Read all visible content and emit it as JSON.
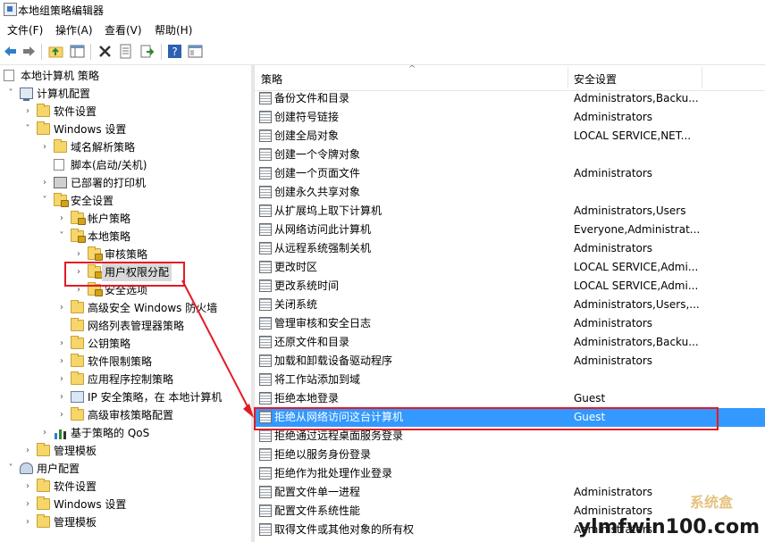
{
  "window": {
    "title": "本地组策略编辑器"
  },
  "menu": [
    "文件(F)",
    "操作(A)",
    "查看(V)",
    "帮助(H)"
  ],
  "toolbar": [
    "back-icon",
    "forward-icon",
    "up-folder-icon",
    "show-hide-tree-icon",
    "delete-icon",
    "properties-icon",
    "export-icon",
    "help-icon",
    "view-icon"
  ],
  "tree": [
    {
      "label": "本地计算机 策略",
      "icon": "doc",
      "expander": "",
      "name": "tree-root-local-policy"
    },
    {
      "label": "计算机配置",
      "icon": "computer",
      "expander": "v",
      "name": "tree-computer-config"
    },
    {
      "label": "软件设置",
      "icon": "folder",
      "expander": ">",
      "name": "tree-software-settings"
    },
    {
      "label": "Windows 设置",
      "icon": "folder",
      "expander": "v",
      "name": "tree-windows-settings"
    },
    {
      "label": "域名解析策略",
      "icon": "folder",
      "expander": ">",
      "name": "tree-name-resolution"
    },
    {
      "label": "脚本(启动/关机)",
      "icon": "doc",
      "expander": "",
      "name": "tree-scripts"
    },
    {
      "label": "已部署的打印机",
      "icon": "printer",
      "expander": ">",
      "name": "tree-printers"
    },
    {
      "label": "安全设置",
      "icon": "folder-lock",
      "expander": "v",
      "name": "tree-security-settings"
    },
    {
      "label": "帐户策略",
      "icon": "folder-lock",
      "expander": ">",
      "name": "tree-account-policies"
    },
    {
      "label": "本地策略",
      "icon": "folder-lock",
      "expander": "v",
      "name": "tree-local-policies"
    },
    {
      "label": "审核策略",
      "icon": "folder-lock",
      "expander": ">",
      "name": "tree-audit-policy"
    },
    {
      "label": "用户权限分配",
      "icon": "folder-lock",
      "expander": ">",
      "name": "tree-user-rights",
      "selected": true
    },
    {
      "label": "安全选项",
      "icon": "folder-lock",
      "expander": ">",
      "name": "tree-security-options"
    },
    {
      "label": "高级安全 Windows 防火墙",
      "icon": "folder",
      "expander": ">",
      "name": "tree-firewall"
    },
    {
      "label": "网络列表管理器策略",
      "icon": "folder",
      "expander": "",
      "name": "tree-network-list"
    },
    {
      "label": "公钥策略",
      "icon": "folder",
      "expander": ">",
      "name": "tree-public-key"
    },
    {
      "label": "软件限制策略",
      "icon": "folder",
      "expander": ">",
      "name": "tree-software-restriction"
    },
    {
      "label": "应用程序控制策略",
      "icon": "folder",
      "expander": ">",
      "name": "tree-app-control"
    },
    {
      "label": "IP 安全策略，在 本地计算机",
      "icon": "shield",
      "expander": ">",
      "name": "tree-ip-security"
    },
    {
      "label": "高级审核策略配置",
      "icon": "folder",
      "expander": ">",
      "name": "tree-advanced-audit"
    },
    {
      "label": "基于策略的 QoS",
      "icon": "chart",
      "expander": ">",
      "name": "tree-qos"
    },
    {
      "label": "管理模板",
      "icon": "folder",
      "expander": ">",
      "name": "tree-admin-templates"
    },
    {
      "label": "用户配置",
      "icon": "user",
      "expander": "v",
      "name": "tree-user-config"
    },
    {
      "label": "软件设置",
      "icon": "folder",
      "expander": ">",
      "name": "tree-user-software-settings"
    },
    {
      "label": "Windows 设置",
      "icon": "folder",
      "expander": ">",
      "name": "tree-user-windows-settings"
    },
    {
      "label": "管理模板",
      "icon": "folder",
      "expander": ">",
      "name": "tree-user-admin-templates"
    }
  ],
  "list": {
    "columns": [
      "策略",
      "安全设置"
    ],
    "rows": [
      {
        "policy": "备份文件和目录",
        "setting": "Administrators,Backu..."
      },
      {
        "policy": "创建符号链接",
        "setting": "Administrators"
      },
      {
        "policy": "创建全局对象",
        "setting": "LOCAL SERVICE,NET..."
      },
      {
        "policy": "创建一个令牌对象",
        "setting": ""
      },
      {
        "policy": "创建一个页面文件",
        "setting": "Administrators"
      },
      {
        "policy": "创建永久共享对象",
        "setting": ""
      },
      {
        "policy": "从扩展坞上取下计算机",
        "setting": "Administrators,Users"
      },
      {
        "policy": "从网络访问此计算机",
        "setting": "Everyone,Administrat..."
      },
      {
        "policy": "从远程系统强制关机",
        "setting": "Administrators"
      },
      {
        "policy": "更改时区",
        "setting": "LOCAL SERVICE,Admi..."
      },
      {
        "policy": "更改系统时间",
        "setting": "LOCAL SERVICE,Admi..."
      },
      {
        "policy": "关闭系统",
        "setting": "Administrators,Users,..."
      },
      {
        "policy": "管理审核和安全日志",
        "setting": "Administrators"
      },
      {
        "policy": "还原文件和目录",
        "setting": "Administrators,Backu..."
      },
      {
        "policy": "加载和卸载设备驱动程序",
        "setting": "Administrators"
      },
      {
        "policy": "将工作站添加到域",
        "setting": ""
      },
      {
        "policy": "拒绝本地登录",
        "setting": "Guest"
      },
      {
        "policy": "拒绝从网络访问这台计算机",
        "setting": "Guest",
        "selected": true
      },
      {
        "policy": "拒绝通过远程桌面服务登录",
        "setting": ""
      },
      {
        "policy": "拒绝以服务身份登录",
        "setting": ""
      },
      {
        "policy": "拒绝作为批处理作业登录",
        "setting": ""
      },
      {
        "policy": "配置文件单一进程",
        "setting": "Administrators"
      },
      {
        "policy": "配置文件系统性能",
        "setting": "Administrators"
      },
      {
        "policy": "取得文件或其他对象的所有权",
        "setting": "Administrators"
      }
    ]
  },
  "watermark": {
    "text": "ylmfwin100.com",
    "sub": "系统盒"
  },
  "colors": {
    "selection": "#3399ff",
    "annotation": "#e31b23",
    "folder": "#f6d56a"
  }
}
